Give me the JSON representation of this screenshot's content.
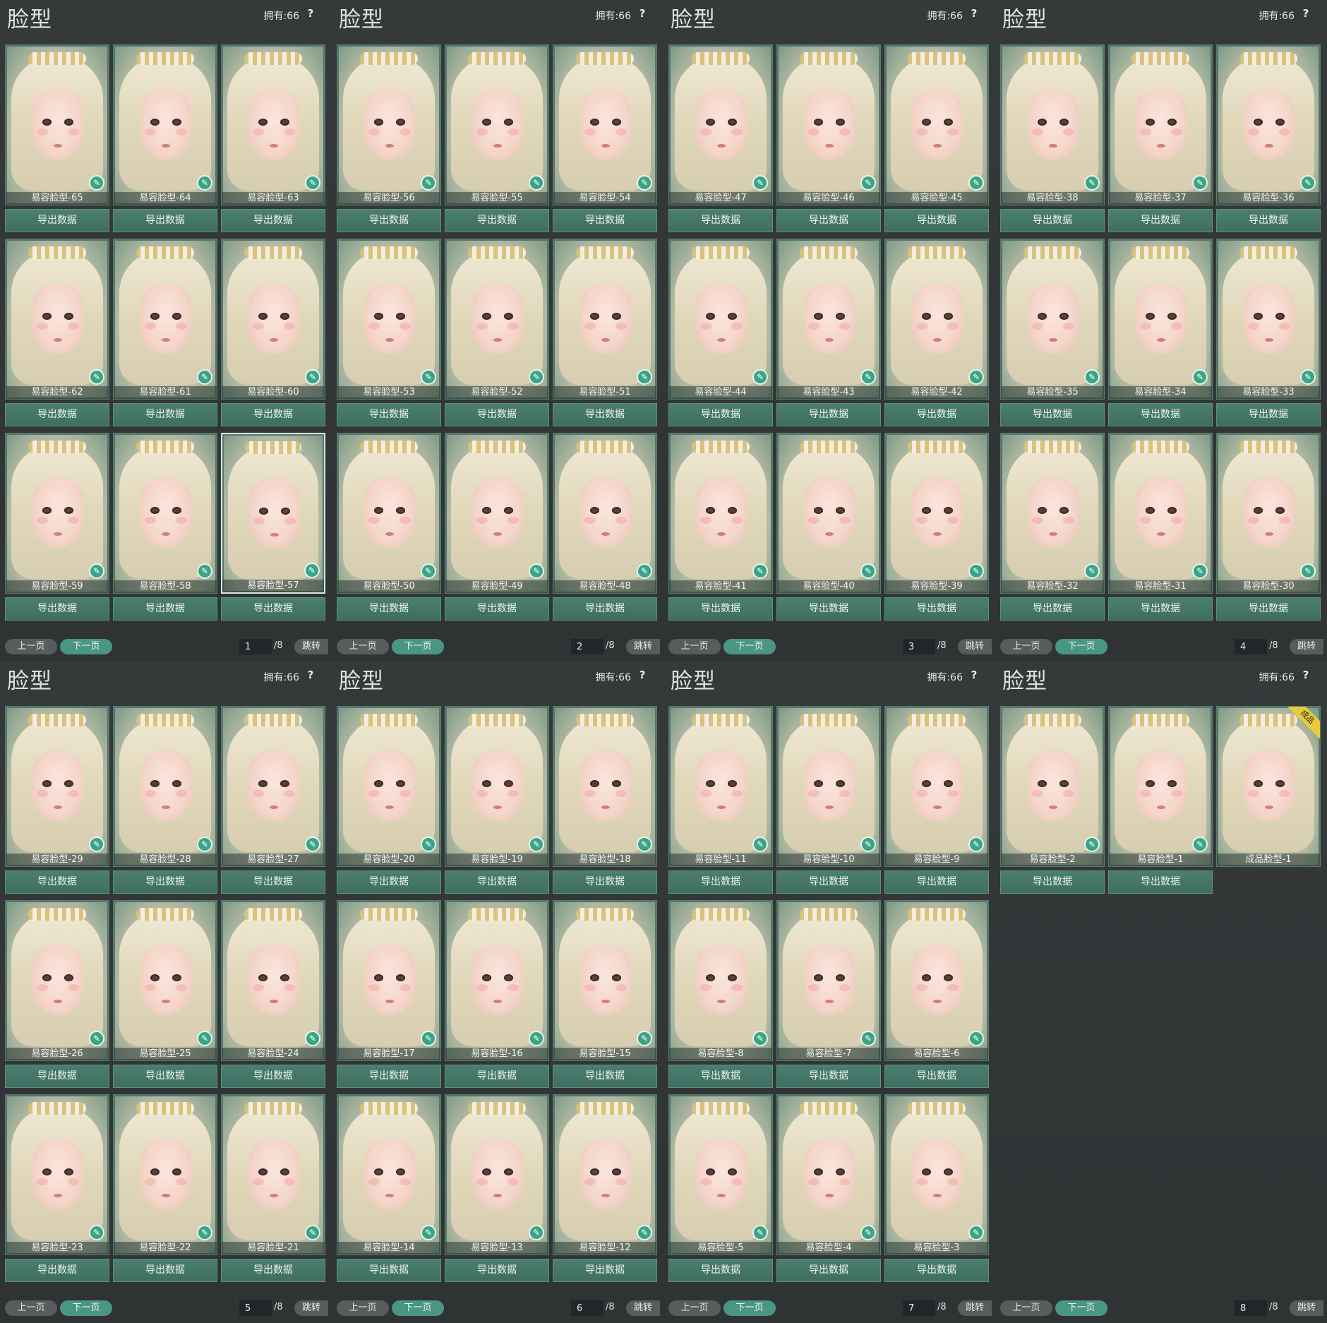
{
  "panel_title": "脸型",
  "owned_text": "拥有:66",
  "help_text": "?",
  "export_label": "导出数据",
  "prev_label": "上一页",
  "next_label": "下一页",
  "jump_label": "跳转",
  "total_pages_text": "/8",
  "badge_text": "成品",
  "colors": {
    "accent": "#4a9684",
    "button": "#3f6e61",
    "background": "#2c2f31",
    "badge": "#e6cc3c"
  },
  "pages": [
    {
      "page": "1",
      "cards": [
        "易容脸型-65",
        "易容脸型-64",
        "易容脸型-63",
        "易容脸型-62",
        "易容脸型-61",
        "易容脸型-60",
        "易容脸型-59",
        "易容脸型-58",
        "易容脸型-57"
      ],
      "selected": 8
    },
    {
      "page": "2",
      "cards": [
        "易容脸型-56",
        "易容脸型-55",
        "易容脸型-54",
        "易容脸型-53",
        "易容脸型-52",
        "易容脸型-51",
        "易容脸型-50",
        "易容脸型-49",
        "易容脸型-48"
      ]
    },
    {
      "page": "3",
      "cards": [
        "易容脸型-47",
        "易容脸型-46",
        "易容脸型-45",
        "易容脸型-44",
        "易容脸型-43",
        "易容脸型-42",
        "易容脸型-41",
        "易容脸型-40",
        "易容脸型-39"
      ]
    },
    {
      "page": "4",
      "cards": [
        "易容脸型-38",
        "易容脸型-37",
        "易容脸型-36",
        "易容脸型-35",
        "易容脸型-34",
        "易容脸型-33",
        "易容脸型-32",
        "易容脸型-31",
        "易容脸型-30"
      ]
    },
    {
      "page": "5",
      "cards": [
        "易容脸型-29",
        "易容脸型-28",
        "易容脸型-27",
        "易容脸型-26",
        "易容脸型-25",
        "易容脸型-24",
        "易容脸型-23",
        "易容脸型-22",
        "易容脸型-21"
      ]
    },
    {
      "page": "6",
      "cards": [
        "易容脸型-20",
        "易容脸型-19",
        "易容脸型-18",
        "易容脸型-17",
        "易容脸型-16",
        "易容脸型-15",
        "易容脸型-14",
        "易容脸型-13",
        "易容脸型-12"
      ]
    },
    {
      "page": "7",
      "cards": [
        "易容脸型-11",
        "易容脸型-10",
        "易容脸型-9",
        "易容脸型-8",
        "易容脸型-7",
        "易容脸型-6",
        "易容脸型-5",
        "易容脸型-4",
        "易容脸型-3"
      ]
    },
    {
      "page": "8",
      "cards": [
        "易容脸型-2",
        "易容脸型-1",
        "成品脸型-1"
      ],
      "badge_card": 2,
      "no_export_cards": [
        2
      ]
    }
  ]
}
